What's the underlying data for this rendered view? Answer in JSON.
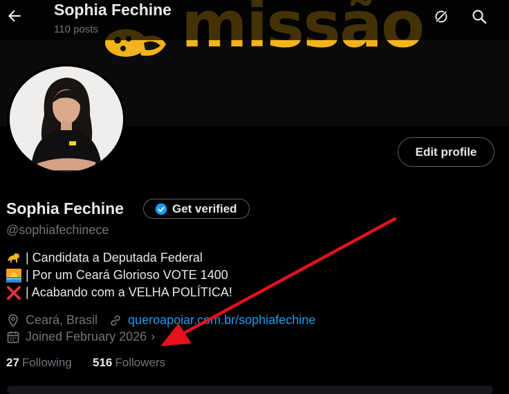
{
  "header": {
    "title": "Sophia Fechine",
    "posts_count": "110 posts"
  },
  "banner": {
    "text": "missão",
    "accent_color": "#f3b31b"
  },
  "profile": {
    "name": "Sophia Fechine",
    "handle": "@sophiafechinece",
    "edit_label": "Edit profile",
    "verify_label": "Get verified",
    "bio": [
      {
        "icon": "horse-icon",
        "text": "| Candidata a Deputada Federal"
      },
      {
        "icon": "sunrise-icon",
        "text": "| Por um Ceará Glorioso VOTE 1400"
      },
      {
        "icon": "red-x-icon",
        "text": "| Acabando com a VELHA POLÍTICA!"
      }
    ],
    "location": "Ceará, Brasil",
    "website": "queroapoiar.com.br/sophiafechine",
    "joined": "Joined February 2026",
    "following_count": "27",
    "following_label": "Following",
    "followers_count": "516",
    "followers_label": "Followers"
  },
  "annotation": {
    "arrow_color": "#e5121b"
  }
}
